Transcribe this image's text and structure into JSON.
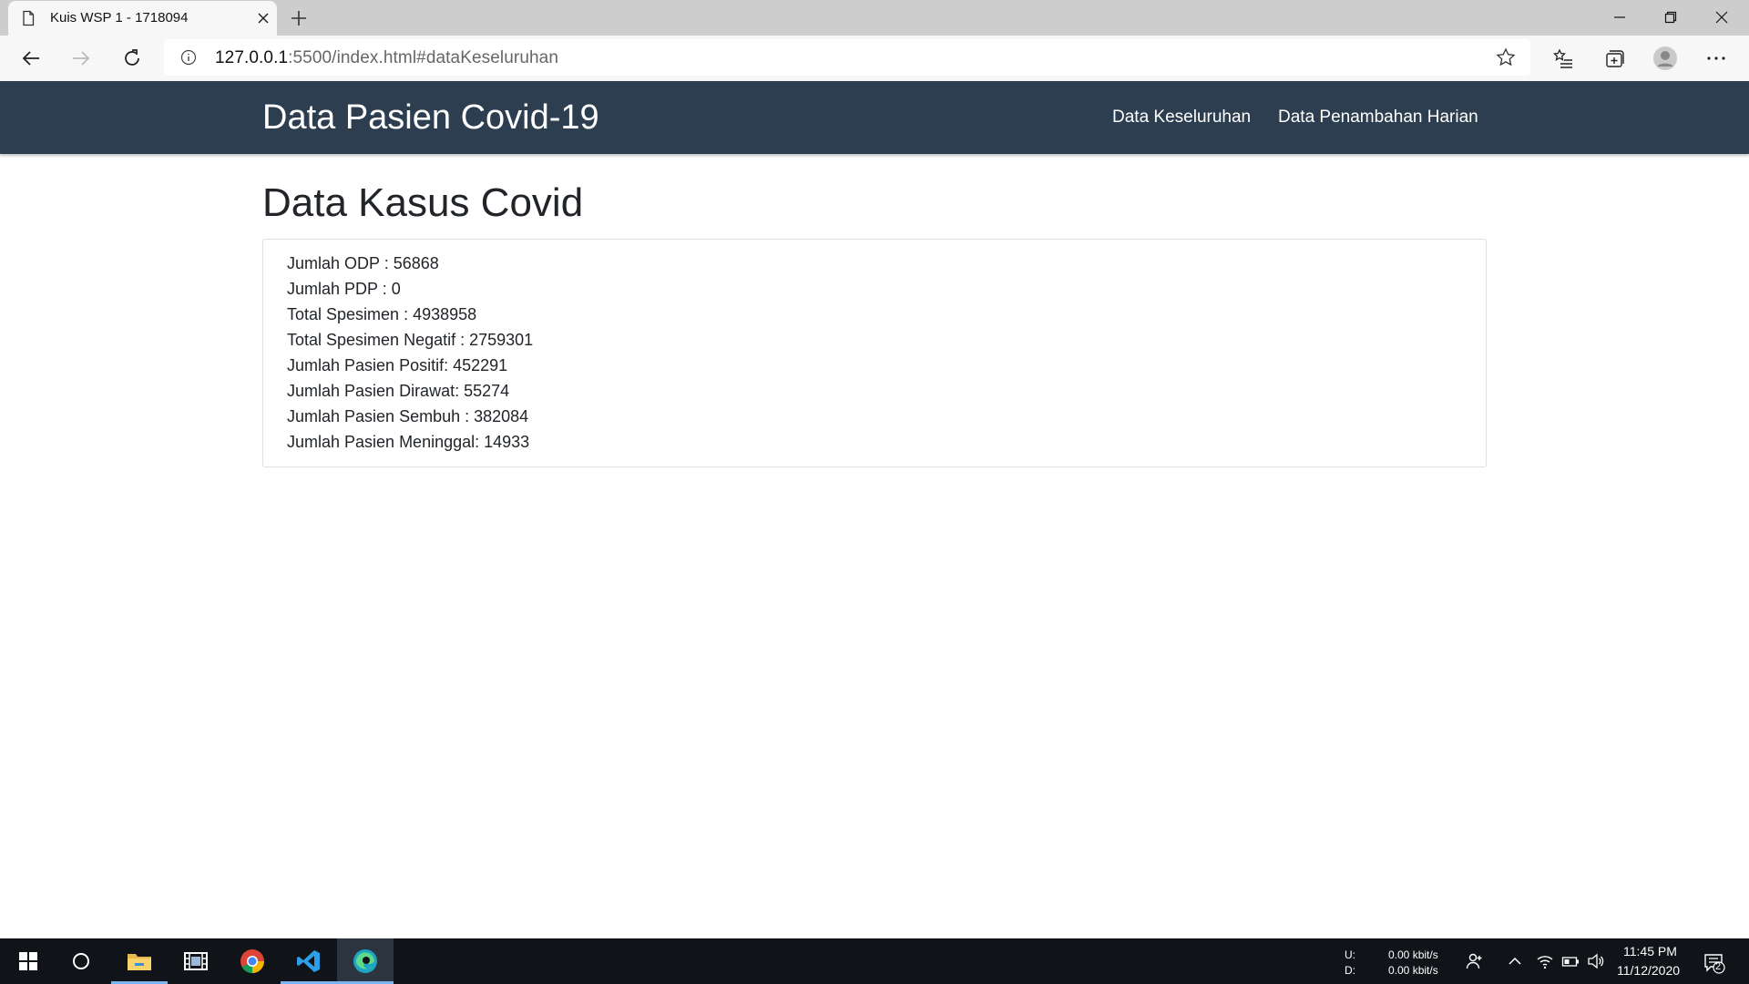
{
  "browser": {
    "tab_title": "Kuis WSP 1 - 1718094",
    "url_host": "127.0.0.1",
    "url_rest": ":5500/index.html#dataKeseluruhan"
  },
  "navbar": {
    "brand": "Data Pasien Covid-19",
    "links": [
      "Data Keseluruhan",
      "Data Penambahan Harian"
    ],
    "background": "#2c3e50"
  },
  "main": {
    "heading": "Data Kasus Covid",
    "stats": [
      "Jumlah ODP : 56868",
      "Jumlah PDP : 0",
      "Total Spesimen : 4938958",
      "Total Spesimen Negatif : 2759301",
      "Jumlah Pasien Positif: 452291",
      "Jumlah Pasien Dirawat: 55274",
      "Jumlah Pasien Sembuh : 382084",
      "Jumlah Pasien Meninggal: 14933"
    ]
  },
  "taskbar": {
    "apps": [
      "windows-start-icon",
      "cortana-search-icon",
      "file-explorer-icon",
      "media-app-icon",
      "chrome-icon",
      "vscode-icon",
      "edge-icon"
    ],
    "net_up_label": "U:",
    "net_down_label": "D:",
    "net_up_value": "0.00 kbit/s",
    "net_down_value": "0.00 kbit/s",
    "time": "11:45 PM",
    "date": "11/12/2020",
    "notification_count": "2"
  }
}
